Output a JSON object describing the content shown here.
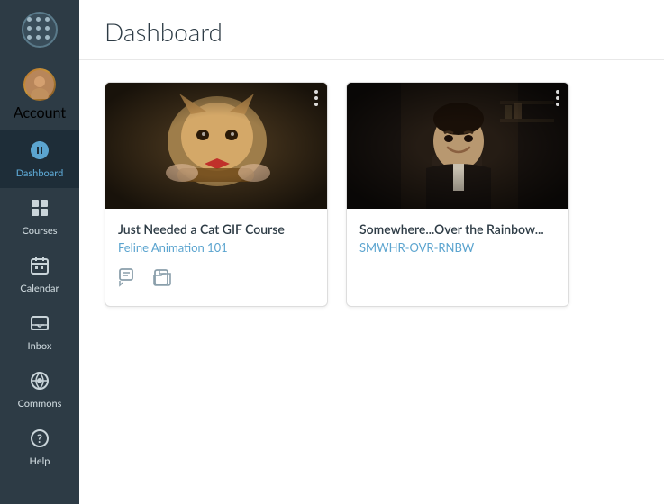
{
  "sidebar": {
    "logo_alt": "Canvas Logo",
    "items": [
      {
        "id": "account",
        "label": "Account",
        "icon": "person",
        "active": false
      },
      {
        "id": "dashboard",
        "label": "Dashboard",
        "icon": "dashboard",
        "active": true
      },
      {
        "id": "courses",
        "label": "Courses",
        "icon": "courses",
        "active": false
      },
      {
        "id": "calendar",
        "label": "Calendar",
        "icon": "calendar",
        "active": false
      },
      {
        "id": "inbox",
        "label": "Inbox",
        "icon": "inbox",
        "active": false
      },
      {
        "id": "commons",
        "label": "Commons",
        "icon": "commons",
        "active": false
      },
      {
        "id": "help",
        "label": "Help",
        "icon": "help",
        "active": false
      }
    ]
  },
  "header": {
    "title": "Dashboard"
  },
  "cards": [
    {
      "id": "card-cat",
      "title": "Just Needed a Cat GIF Course",
      "subtitle": "Feline Animation 101",
      "menu_label": "more options"
    },
    {
      "id": "card-seinfeld",
      "title": "Somewhere...Over the Rainbow...",
      "subtitle": "SMWHR-OVR-RNBW",
      "menu_label": "more options"
    }
  ]
}
